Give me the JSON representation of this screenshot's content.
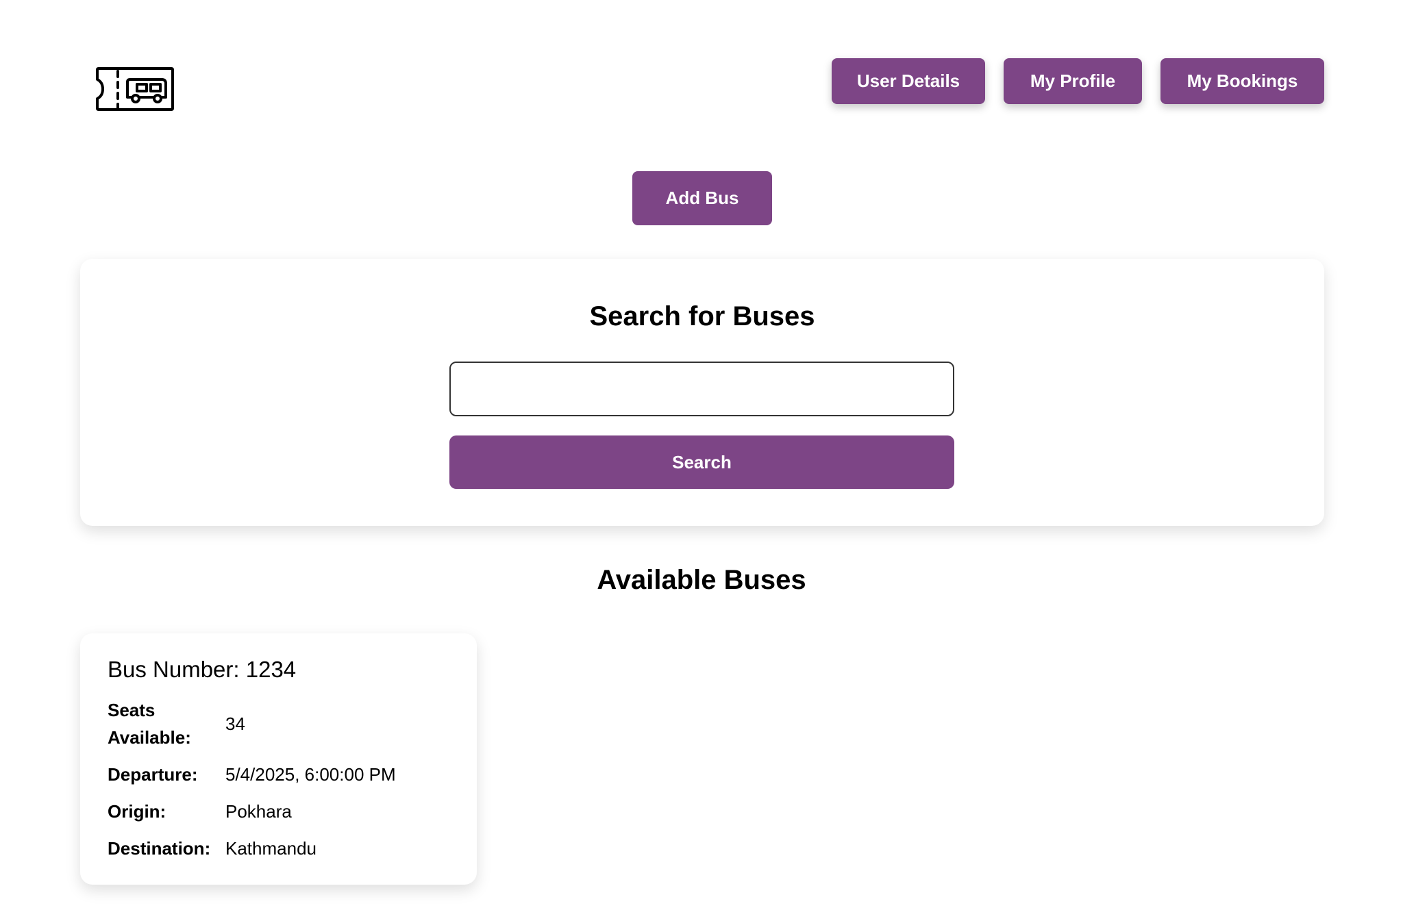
{
  "header": {
    "logo_icon": "bus-ticket-icon",
    "nav": {
      "user_details": "User Details",
      "my_profile": "My Profile",
      "my_bookings": "My Bookings"
    }
  },
  "actions": {
    "add_bus": "Add Bus"
  },
  "search": {
    "title": "Search for Buses",
    "input_value": "",
    "button": "Search"
  },
  "available": {
    "title": "Available Buses",
    "buses": [
      {
        "bus_number": "Bus Number: 1234",
        "seats_label": "Seats Available:",
        "seats_value": "34",
        "departure_label": "Departure:",
        "departure_value": "5/4/2025, 6:00:00 PM",
        "origin_label": "Origin:",
        "origin_value": "Pokhara",
        "destination_label": "Destination:",
        "destination_value": "Kathmandu"
      }
    ]
  },
  "colors": {
    "accent": "#7d4586"
  }
}
